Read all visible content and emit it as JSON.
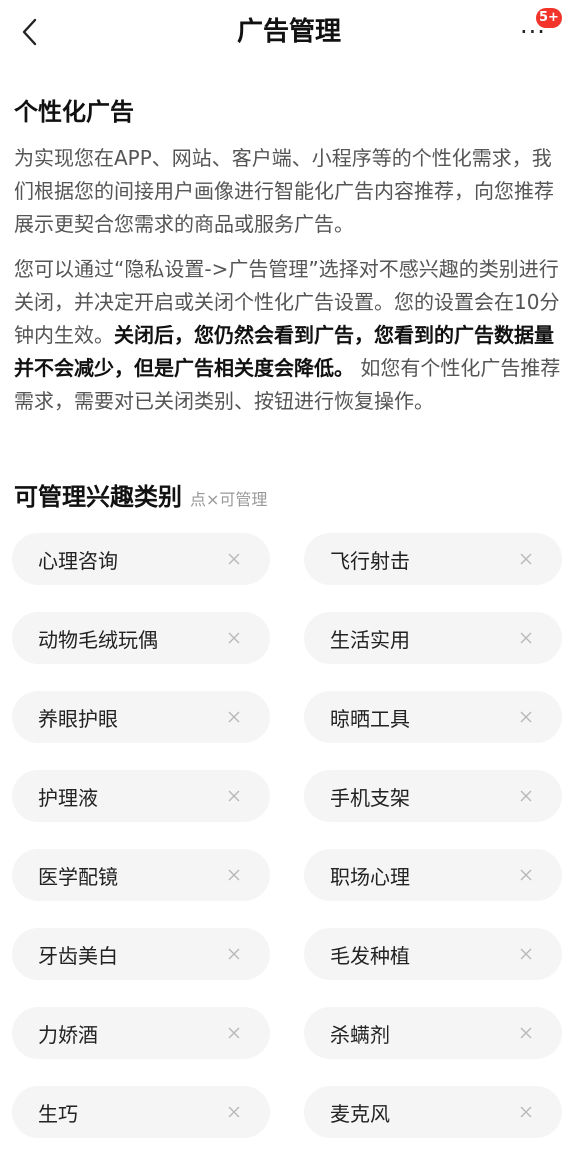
{
  "nav": {
    "title": "广告管理",
    "more_dots": "···",
    "badge": "5+"
  },
  "personalized": {
    "title": "个性化广告",
    "para1": "为实现您在APP、网站、客户端、小程序等的个性化需求，我们根据您的间接用户画像进行智能化广告内容推荐，向您推荐展示更契合您需求的商品或服务广告。",
    "para2_part1": "您可以通过“隐私设置->广告管理”选择对不感兴趣的类别进行关闭，并决定开启或关闭个性化广告设置。您的设置会在10分钟内生效。",
    "para2_bold": "关闭后，您仍然会看到广告，您看到的广告数据量并不会减少，但是广告相关度会降低。",
    "para2_part2": " 如您有个性化广告推荐需求，需要对已关闭类别、按钮进行恢复操作。"
  },
  "interests": {
    "title": "可管理兴趣类别",
    "hint": "点×可管理",
    "tags": [
      "心理咨询",
      "飞行射击",
      "动物毛绒玩偶",
      "生活实用",
      "养眼护眼",
      "晾晒工具",
      "护理液",
      "手机支架",
      "医学配镜",
      "职场心理",
      "牙齿美白",
      "毛发种植",
      "力娇酒",
      "杀螨剂",
      "生巧",
      "麦克风"
    ]
  },
  "colors": {
    "badge": "#f2342b",
    "tag_bg": "#f5f5f5",
    "hint": "#999999",
    "body_text": "#555555"
  },
  "icons": {
    "back": "chevron-left-icon",
    "close": "close-icon"
  }
}
